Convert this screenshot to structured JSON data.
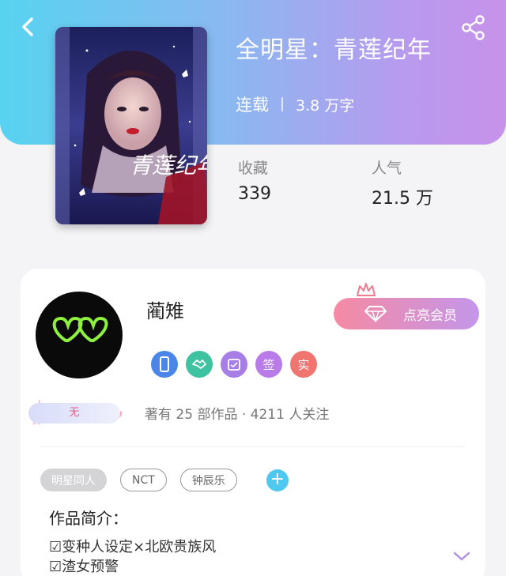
{
  "header": {
    "back_icon": "chevron-left-icon",
    "share_icon": "share-icon",
    "colors": {
      "gradient_start": "#57d3f0",
      "gradient_end": "#c792ea"
    }
  },
  "book": {
    "title": "全明星：青莲纪年",
    "status": "连载",
    "word_count": "3.8 万字",
    "cover_text": "青莲纪年",
    "stats": [
      {
        "label": "收藏",
        "value": "339"
      },
      {
        "label": "人气",
        "value": "21.5 万"
      }
    ]
  },
  "author": {
    "name": "蔺雉",
    "vip_button": "点亮会员",
    "badges": [
      {
        "icon": "phone-icon",
        "text": "",
        "color": "#4a86e8"
      },
      {
        "icon": "handshake-icon",
        "text": "",
        "color": "#3ec2a0"
      },
      {
        "icon": "calendar-icon",
        "text": "",
        "color": "#a77ee6"
      },
      {
        "icon": "sign-icon",
        "text": "签",
        "color": "#b97be8"
      },
      {
        "icon": "verified-icon",
        "text": "实",
        "color": "#f07470"
      }
    ],
    "level_label": "无",
    "stats_text": "著有 25 部作品 · 4211 人关注"
  },
  "tags": [
    {
      "label": "明星同人",
      "style": "filled"
    },
    {
      "label": "NCT",
      "style": "outline"
    },
    {
      "label": "钟辰乐",
      "style": "outline"
    }
  ],
  "intro": {
    "title": "作品简介：",
    "lines": [
      "☑变种人设定×北欧贵族风",
      "☑渣女预警"
    ]
  }
}
